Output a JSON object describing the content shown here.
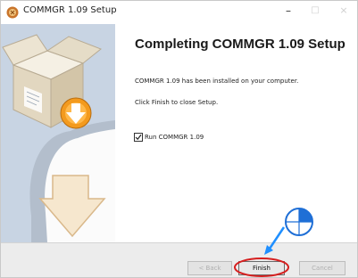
{
  "window": {
    "title": "COMMGR 1.09 Setup"
  },
  "controls": {
    "minimize": "–",
    "maximize": "□",
    "close": "×"
  },
  "main": {
    "heading": "Completing COMMGR 1.09 Setup",
    "line1": "COMMGR 1.09 has been installed on your computer.",
    "line2": "Click Finish to close Setup.",
    "checkbox": {
      "label": "Run COMMGR 1.09",
      "checked": true
    }
  },
  "buttons": {
    "back": "< Back",
    "finish": "Finish",
    "cancel": "Cancel"
  },
  "colors": {
    "side_panel": "#c8d4e3",
    "highlight": "#d61f1f",
    "pointer": "#1f8fff"
  }
}
